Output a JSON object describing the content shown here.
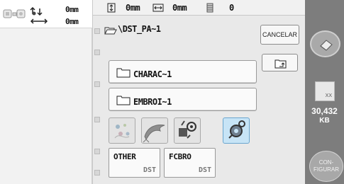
{
  "preview": {
    "width": "0mm",
    "height": "0mm"
  },
  "topbar": {
    "height_value": "0mm",
    "width_value": "0mm",
    "stitch_count": "0"
  },
  "path": {
    "current_folder": "\\DST_PA~1"
  },
  "folders": [
    {
      "label": "CHARAC~1"
    },
    {
      "label": "EMBROI~1"
    }
  ],
  "buttons": {
    "cancel": "CANCELAR",
    "config": "CON-\nFIGURAR"
  },
  "thumbnails": [
    {
      "name": "floral-pattern-icon"
    },
    {
      "name": "dolphin-icon"
    },
    {
      "name": "machine-gear-icon"
    },
    {
      "name": "gear-embroidery-icon",
      "selected": true
    }
  ],
  "files": [
    {
      "name": "OTHER",
      "ext": "DST"
    },
    {
      "name": "FCBRO",
      "ext": "DST"
    }
  ],
  "storage": {
    "free_size": "30,432",
    "unit": "KB",
    "icon_label": "XX"
  },
  "colors": {
    "right_panel": "#7d7d7d",
    "selected_thumb": "#c7e4f6"
  }
}
